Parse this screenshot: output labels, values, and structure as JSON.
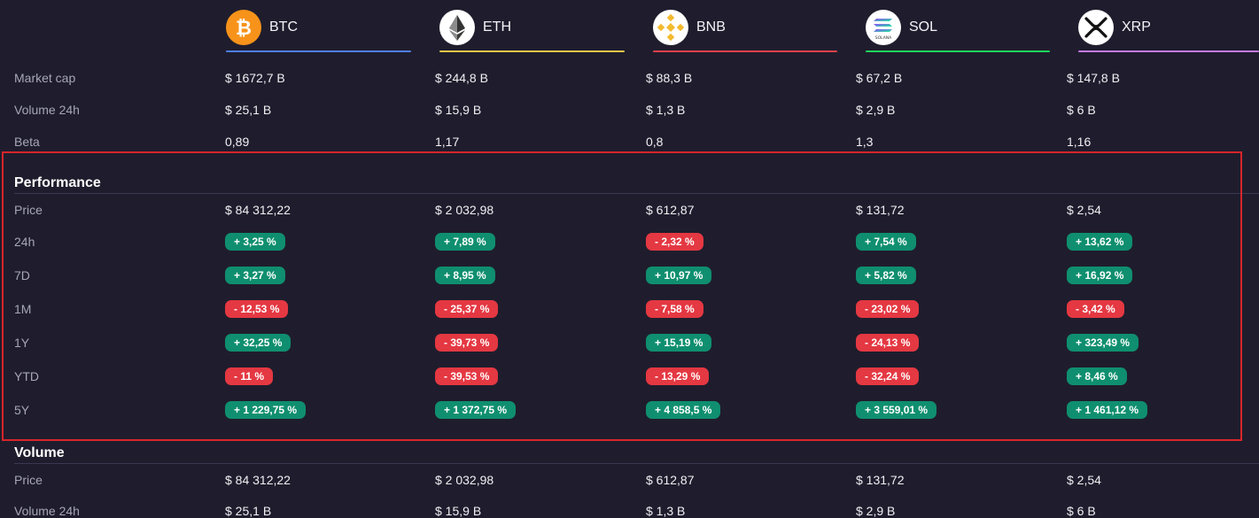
{
  "coins": [
    {
      "symbol": "BTC",
      "color": "#4f7ff0",
      "logo": "btc-icon"
    },
    {
      "symbol": "ETH",
      "color": "#e8c64a",
      "logo": "eth-icon"
    },
    {
      "symbol": "BNB",
      "color": "#e5414b",
      "logo": "bnb-icon"
    },
    {
      "symbol": "SOL",
      "color": "#1fd65a",
      "logo": "sol-icon"
    },
    {
      "symbol": "XRP",
      "color": "#c57ae8",
      "logo": "xrp-icon"
    }
  ],
  "sol_logo_text": "SOLANA",
  "overview": [
    {
      "label": "Market cap",
      "values": [
        "$ 1672,7 B",
        "$ 244,8 B",
        "$ 88,3 B",
        "$ 67,2 B",
        "$ 147,8 B"
      ]
    },
    {
      "label": "Volume 24h",
      "values": [
        "$ 25,1 B",
        "$ 15,9 B",
        "$ 1,3 B",
        "$ 2,9 B",
        "$ 6 B"
      ]
    },
    {
      "label": "Beta",
      "values": [
        "0,89",
        "1,17",
        "0,8",
        "1,3",
        "1,16"
      ]
    }
  ],
  "performance": {
    "title": "Performance",
    "price": {
      "label": "Price",
      "values": [
        "$ 84 312,22",
        "$ 2 032,98",
        "$ 612,87",
        "$ 131,72",
        "$ 2,54"
      ]
    },
    "rows": [
      {
        "label": "24h",
        "values": [
          "+ 3,25 %",
          "+ 7,89 %",
          "- 2,32 %",
          "+ 7,54 %",
          "+ 13,62 %"
        ]
      },
      {
        "label": "7D",
        "values": [
          "+ 3,27 %",
          "+ 8,95 %",
          "+ 10,97 %",
          "+ 5,82 %",
          "+ 16,92 %"
        ]
      },
      {
        "label": "1M",
        "values": [
          "- 12,53 %",
          "- 25,37 %",
          "- 7,58 %",
          "- 23,02 %",
          "- 3,42 %"
        ]
      },
      {
        "label": "1Y",
        "values": [
          "+ 32,25 %",
          "- 39,73 %",
          "+ 15,19 %",
          "- 24,13 %",
          "+ 323,49 %"
        ]
      },
      {
        "label": "YTD",
        "values": [
          "- 11 %",
          "- 39,53 %",
          "- 13,29 %",
          "- 32,24 %",
          "+ 8,46 %"
        ]
      },
      {
        "label": "5Y",
        "values": [
          "+ 1 229,75 %",
          "+ 1 372,75 %",
          "+ 4 858,5 %",
          "+ 3 559,01 %",
          "+ 1 461,12 %"
        ]
      }
    ]
  },
  "volume": {
    "title": "Volume",
    "rows": [
      {
        "label": "Price",
        "values": [
          "$ 84 312,22",
          "$ 2 032,98",
          "$ 612,87",
          "$ 131,72",
          "$ 2,54"
        ]
      },
      {
        "label": "Volume 24h",
        "values": [
          "$ 25,1 B",
          "$ 15,9 B",
          "$ 1,3 B",
          "$ 2,9 B",
          "$ 6 B"
        ]
      }
    ]
  },
  "colors": {
    "positive": "#0f8f6f",
    "negative": "#e43842",
    "highlight": "#d7252a"
  }
}
